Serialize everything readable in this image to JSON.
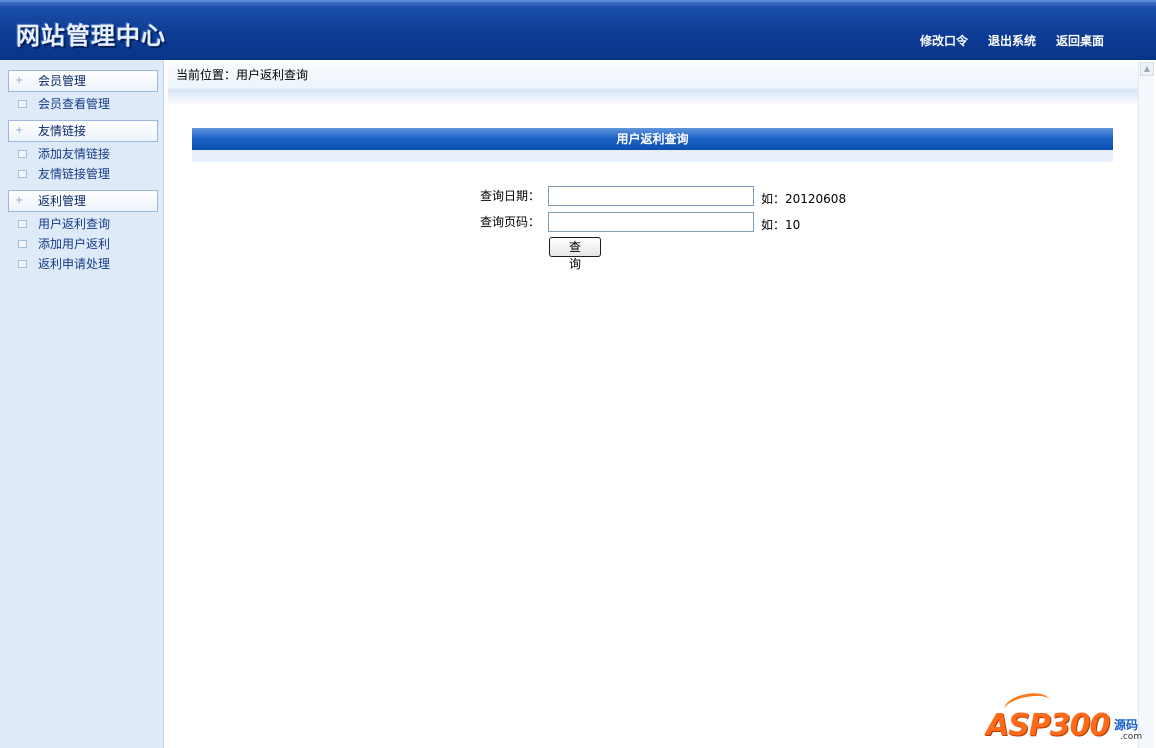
{
  "header": {
    "logo_text": "网站管理中心",
    "nav": [
      "修改口令",
      "退出系统",
      "返回桌面"
    ]
  },
  "sidebar": {
    "sections": [
      {
        "title": "会员管理",
        "items": [
          "会员查看管理"
        ]
      },
      {
        "title": "友情链接",
        "items": [
          "添加友情链接",
          "友情链接管理"
        ]
      },
      {
        "title": "返利管理",
        "items": [
          "用户返利查询",
          "添加用户返利",
          "返利申请处理"
        ]
      }
    ]
  },
  "breadcrumb": {
    "text": "当前位置：用户返利查询"
  },
  "panel": {
    "title": "用户返利查询"
  },
  "form": {
    "date_label": "查询日期：",
    "date_value": "",
    "date_hint": "如：20120608",
    "page_label": "查询页码：",
    "page_value": "",
    "page_hint": "如：10",
    "submit_label": "查 询"
  },
  "watermark": {
    "brand": "ASP300",
    "side": "源码",
    "suffix": ".com"
  }
}
